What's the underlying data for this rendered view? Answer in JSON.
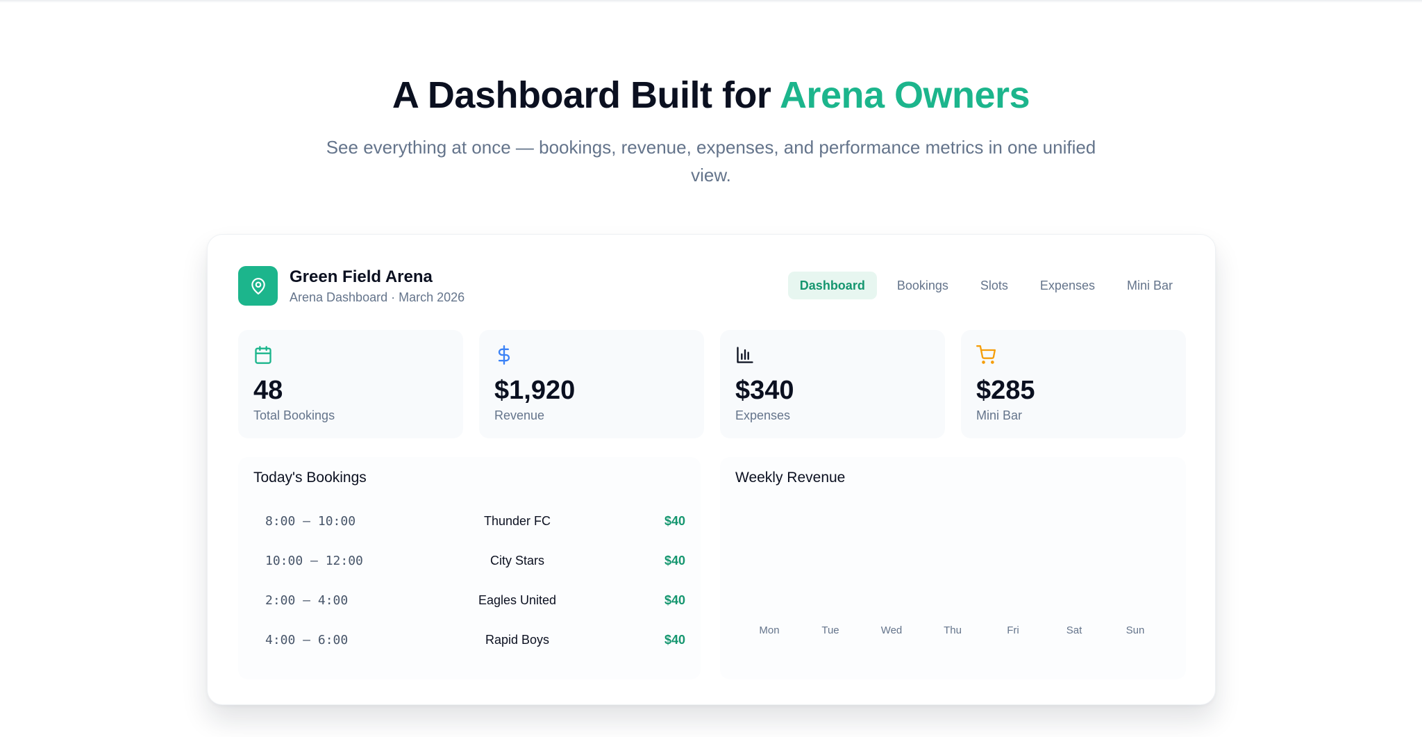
{
  "hero": {
    "title_main": "A Dashboard Built for ",
    "title_accent": "Arena Owners",
    "subtitle": "See everything at once — bookings, revenue, expenses, and performance metrics in one unified view."
  },
  "colors": {
    "accent": "#1cb58c",
    "accent_dark": "#15966f",
    "revenue_icon": "#3b82f6",
    "minibar_icon": "#f59e0b"
  },
  "dashboard": {
    "brand": {
      "name": "Green Field Arena",
      "subtitle": "Arena Dashboard · March 2026",
      "icon": "map-pin-icon"
    },
    "nav": [
      {
        "label": "Dashboard",
        "active": true
      },
      {
        "label": "Bookings",
        "active": false
      },
      {
        "label": "Slots",
        "active": false
      },
      {
        "label": "Expenses",
        "active": false
      },
      {
        "label": "Mini Bar",
        "active": false
      }
    ],
    "stats": [
      {
        "icon": "calendar-icon",
        "value": "48",
        "label": "Total Bookings"
      },
      {
        "icon": "dollar-icon",
        "value": "$1,920",
        "label": "Revenue"
      },
      {
        "icon": "bar-chart-icon",
        "value": "$340",
        "label": "Expenses"
      },
      {
        "icon": "cart-icon",
        "value": "$285",
        "label": "Mini Bar"
      }
    ],
    "bookings": {
      "title": "Today's Bookings",
      "rows": [
        {
          "time": "8:00 – 10:00",
          "team": "Thunder FC",
          "price": "$40"
        },
        {
          "time": "10:00 – 12:00",
          "team": "City Stars",
          "price": "$40"
        },
        {
          "time": "2:00 – 4:00",
          "team": "Eagles United",
          "price": "$40"
        },
        {
          "time": "4:00 – 6:00",
          "team": "Rapid Boys",
          "price": "$40"
        }
      ]
    },
    "weekly_revenue": {
      "title": "Weekly Revenue",
      "days": [
        "Mon",
        "Tue",
        "Wed",
        "Thu",
        "Fri",
        "Sat",
        "Sun"
      ]
    }
  }
}
